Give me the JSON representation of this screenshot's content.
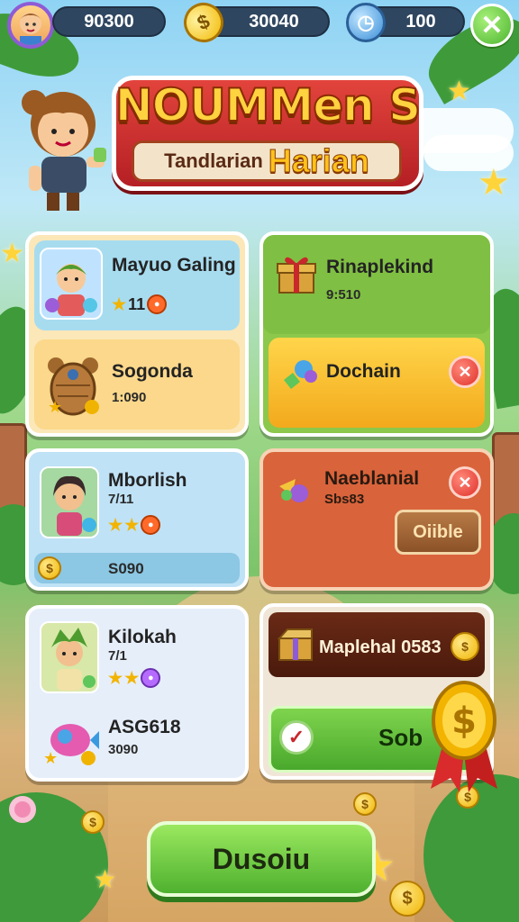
{
  "topbar": {
    "currency1": "90300",
    "currency2": "30040",
    "currency3": "100"
  },
  "banner": {
    "title": "NOUMMen S",
    "subtitle_a": "Tandlarian",
    "subtitle_b": "Harian"
  },
  "cards": {
    "c1": {
      "top_name": "Mayuo Galing",
      "top_stars": "11",
      "bottom_name": "Sogonda",
      "bottom_value": "1:090"
    },
    "c2": {
      "top_name": "Rinaplekind",
      "top_value": "9:510",
      "bottom_name": "Dochain"
    },
    "c3": {
      "name": "Mborlish",
      "sub": "7/11",
      "footer_value": "S090"
    },
    "c4": {
      "name": "Naeblanial",
      "value": "Sbs83",
      "button": "Oiible"
    },
    "c5": {
      "name": "Kilokah",
      "sub": "7/1",
      "bottom_name": "ASG618",
      "bottom_value": "3090"
    },
    "c6": {
      "top_label": "Maplehal 0583",
      "bottom_label": "Sob"
    }
  },
  "main_button": "Dusoiu",
  "colors": {
    "accent_green": "#4fb12f",
    "banner_red": "#c8272b",
    "title_gold": "#ffd23f"
  }
}
